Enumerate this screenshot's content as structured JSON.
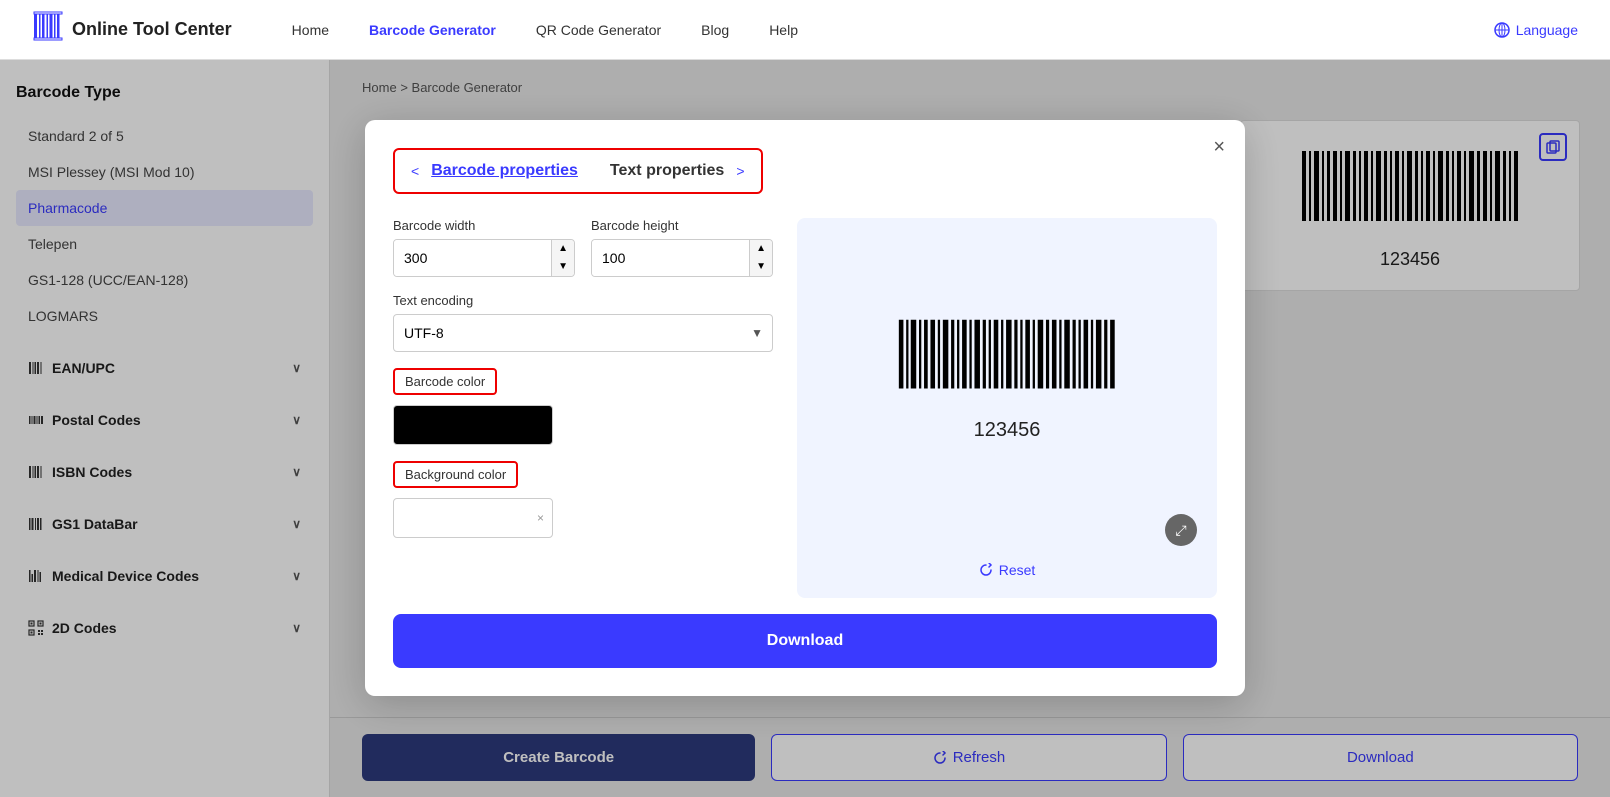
{
  "header": {
    "logo_text": "Online Tool Center",
    "nav": [
      {
        "label": "Home",
        "active": false
      },
      {
        "label": "Barcode Generator",
        "active": true
      },
      {
        "label": "QR Code Generator",
        "active": false
      },
      {
        "label": "Blog",
        "active": false
      },
      {
        "label": "Help",
        "active": false
      }
    ],
    "language_label": "Language"
  },
  "sidebar": {
    "title": "Barcode Type",
    "items": [
      {
        "label": "Standard 2 of 5",
        "active": false
      },
      {
        "label": "MSI Plessey (MSI Mod 10)",
        "active": false
      },
      {
        "label": "Pharmacode",
        "active": true
      },
      {
        "label": "Telepen",
        "active": false
      },
      {
        "label": "GS1-128 (UCC/EAN-128)",
        "active": false
      },
      {
        "label": "LOGMARS",
        "active": false
      }
    ],
    "groups": [
      {
        "label": "EAN/UPC",
        "has_children": true
      },
      {
        "label": "Postal Codes",
        "has_children": true
      },
      {
        "label": "ISBN Codes",
        "has_children": true
      },
      {
        "label": "GS1 DataBar",
        "has_children": true
      },
      {
        "label": "Medical Device Codes",
        "has_children": true
      },
      {
        "label": "2D Codes",
        "has_children": true
      }
    ]
  },
  "breadcrumb": {
    "home": "Home",
    "separator": ">",
    "current": "Barcode Generator"
  },
  "bottom_bar": {
    "create_label": "Create Barcode",
    "refresh_label": "Refresh",
    "download_label": "Download"
  },
  "modal": {
    "tab_barcode_props": "Barcode properties",
    "tab_text_props": "Text properties",
    "close_label": "×",
    "barcode_width_label": "Barcode width",
    "barcode_width_value": "300",
    "barcode_height_label": "Barcode height",
    "barcode_height_value": "100",
    "text_encoding_label": "Text encoding",
    "text_encoding_value": "UTF-8",
    "barcode_color_label": "Barcode color",
    "background_color_label": "Background color",
    "barcode_number": "123456",
    "reset_label": "Reset",
    "download_label": "Download",
    "zoom_icon": "⤢"
  },
  "bg_barcode": {
    "number": "123456"
  }
}
